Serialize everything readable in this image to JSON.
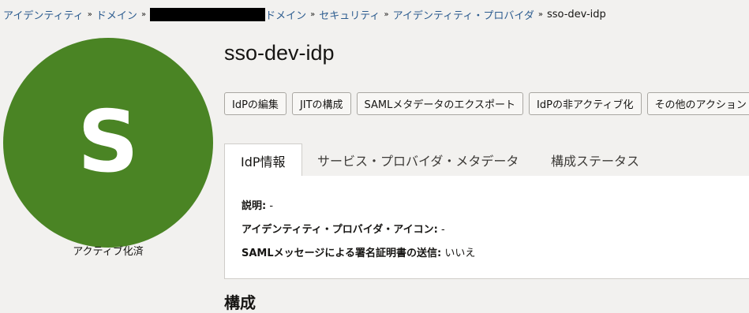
{
  "breadcrumb": {
    "items": [
      "アイデンティティ",
      "ドメイン",
      "ドメイン",
      "セキュリティ",
      "アイデンティティ・プロバイダ"
    ],
    "separator": "»",
    "current": "sso-dev-idp"
  },
  "avatar": {
    "letter": "S",
    "color": "#4a8424"
  },
  "status": {
    "text": "アクティブ化済"
  },
  "page": {
    "title": "sso-dev-idp"
  },
  "actions": {
    "edit": "IdPの編集",
    "jit": "JITの構成",
    "export": "SAMLメタデータのエクスポート",
    "deactivate": "IdPの非アクティブ化",
    "more": "その他のアクション"
  },
  "tabs": {
    "info": "IdP情報",
    "sp_metadata": "サービス・プロバイダ・メタデータ",
    "config_status": "構成ステータス"
  },
  "details": {
    "description_label": "説明:",
    "description_value": "-",
    "icon_label": "アイデンティティ・プロバイダ・アイコン:",
    "icon_value": "-",
    "signing_label": "SAMLメッセージによる署名証明書の送信:",
    "signing_value": "いいえ"
  },
  "section": {
    "partial": "構成"
  }
}
